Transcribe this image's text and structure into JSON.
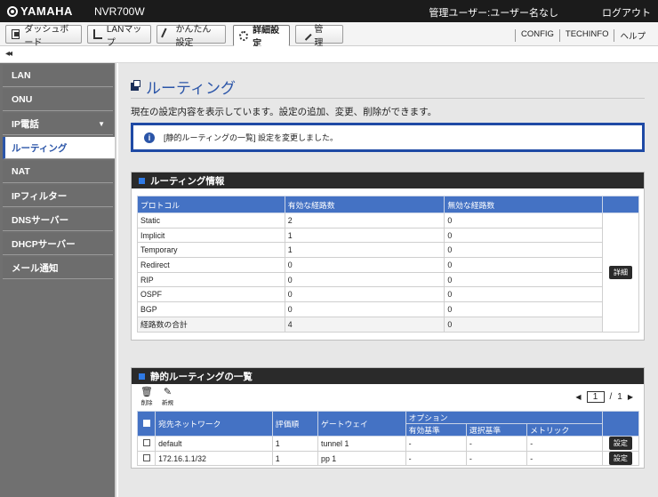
{
  "header": {
    "logo": "YAMAHA",
    "product": "NVR700W",
    "user": "管理ユーザー:ユーザー名なし",
    "logout": "ログアウト"
  },
  "toolbar": {
    "tabs": [
      {
        "label": "ダッシュボード",
        "icon": "dashboard-icon"
      },
      {
        "label": "LANマップ",
        "icon": "lan-map-icon"
      },
      {
        "label": "かんたん設定",
        "icon": "wand-icon"
      },
      {
        "label": "詳細設定",
        "icon": "gear-icon"
      },
      {
        "label": "管　理",
        "icon": "wrench-icon"
      }
    ],
    "active_tab": "詳細設定",
    "right_links": [
      "CONFIG",
      "TECHINFO",
      "ヘルプ"
    ]
  },
  "sidebar": {
    "collapse": "◂◂",
    "items": [
      {
        "label": "LAN"
      },
      {
        "label": "ONU"
      },
      {
        "label": "IP電話",
        "caret": "▼"
      },
      {
        "label": "ルーティング",
        "active": true
      },
      {
        "label": "NAT"
      },
      {
        "label": "IPフィルター"
      },
      {
        "label": "DNSサーバー"
      },
      {
        "label": "DHCPサーバー"
      },
      {
        "label": "メール通知"
      }
    ]
  },
  "main": {
    "title": "ルーティング",
    "description": "現在の設定内容を表示しています。設定の追加、変更、削除ができます。",
    "notice": "[静的ルーティングの一覧] 設定を変更しました。",
    "routing_info": {
      "heading": "ルーティング情報",
      "columns": [
        "プロトコル",
        "有効な経路数",
        "無効な経路数"
      ],
      "rows": [
        [
          "Static",
          "2",
          "0"
        ],
        [
          "Implicit",
          "1",
          "0"
        ],
        [
          "Temporary",
          "1",
          "0"
        ],
        [
          "Redirect",
          "0",
          "0"
        ],
        [
          "RIP",
          "0",
          "0"
        ],
        [
          "OSPF",
          "0",
          "0"
        ],
        [
          "BGP",
          "0",
          "0"
        ],
        [
          "経路数の合計",
          "4",
          "0"
        ]
      ],
      "detail_button": "詳細"
    },
    "static_routes": {
      "heading": "静的ルーティングの一覧",
      "delete_label": "削除",
      "new_label": "新規",
      "pager": {
        "current": "1",
        "separator": "/",
        "total": "1"
      },
      "columns": [
        "宛先ネットワーク",
        "評価順",
        "ゲートウェイ",
        "オプション"
      ],
      "option_columns": [
        "有効基準",
        "選択基準",
        "メトリック"
      ],
      "rows": [
        [
          "default",
          "1",
          "tunnel 1",
          "-",
          "-",
          "-"
        ],
        [
          "172.16.1.1/32",
          "1",
          "pp 1",
          "-",
          "-",
          "-"
        ]
      ],
      "row_button": "設定"
    }
  }
}
